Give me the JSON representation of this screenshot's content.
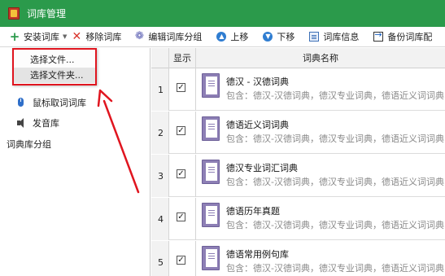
{
  "window": {
    "title": "词库管理"
  },
  "toolbar": {
    "install": "安装词库",
    "remove": "移除词库",
    "edit_groups": "编辑词库分组",
    "move_up": "上移",
    "move_down": "下移",
    "info": "词库信息",
    "backup": "备份词库配"
  },
  "dropdown": {
    "items": [
      "选择文件...",
      "选择文件夹..."
    ]
  },
  "left_panel": {
    "mouse_lookup": "鼠标取词词库",
    "pronunciation": "发音库",
    "groups_label": "词典库分组"
  },
  "table": {
    "headers": {
      "num": "",
      "show": "显示",
      "name": "词典名称"
    },
    "check_mark": "✓",
    "rows": [
      {
        "num": "1",
        "name": "德汉 - 汉德词典",
        "desc": "包含：德汉-汉德词典，德汉专业词典，德语近义词词典"
      },
      {
        "num": "2",
        "name": "德语近义词词典",
        "desc": "包含：德汉-汉德词典，德汉专业词典，德语近义词词典"
      },
      {
        "num": "3",
        "name": "德汉专业词汇词典",
        "desc": "包含：德汉-汉德词典，德汉专业词典，德语近义词词典"
      },
      {
        "num": "4",
        "name": "德语历年真题",
        "desc": "包含：德汉-汉德词典，德汉专业词典，德语近义词词典"
      },
      {
        "num": "5",
        "name": "德语常用例句库",
        "desc": "包含：德汉-汉德词典，德汉专业词典，德语近义词词典"
      }
    ]
  },
  "colors": {
    "titlebar": "#2b9a4b",
    "highlight_red": "#e0151f",
    "book_purple": "#8d7fb5"
  }
}
